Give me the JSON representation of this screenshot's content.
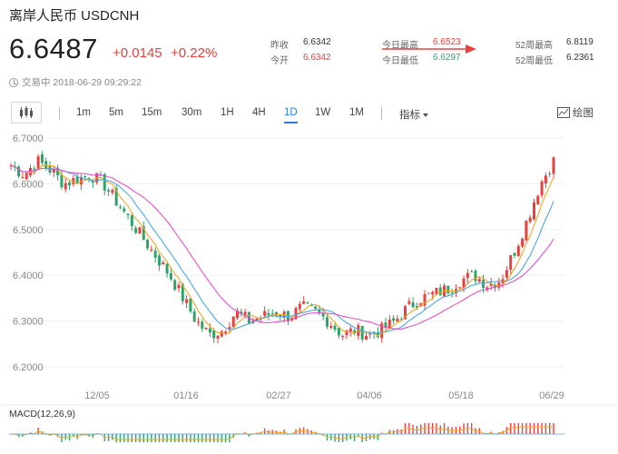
{
  "header": {
    "title": "离岸人民币  USDCNH",
    "price": "6.6487",
    "change_abs": "+0.0145",
    "change_pct": "+0.22%",
    "status": "交易中 2018-06-29 09:29:22"
  },
  "stats": {
    "prev_close_label": "昨收",
    "prev_close": "6.6342",
    "open_label": "今开",
    "open": "6.6342",
    "day_high_label": "今日最高",
    "day_high": "6.6523",
    "day_low_label": "今日最低",
    "day_low": "6.6297",
    "wk52_high_label": "52周最高",
    "wk52_high": "6.8119",
    "wk52_low_label": "52周最低",
    "wk52_low": "6.2361"
  },
  "toolbar": {
    "periods": [
      "1m",
      "5m",
      "15m",
      "30m",
      "1H",
      "4H",
      "1D",
      "1W",
      "1M"
    ],
    "active_period": "1D",
    "indicator_label": "指标",
    "draw_label": "绘图"
  },
  "colors": {
    "up": "#e8403f",
    "down": "#2ea46a",
    "ma_short": "#f5a623",
    "ma_mid": "#4aa8e8",
    "ma_long": "#e84fc8",
    "arrow": "#e8403f",
    "active": "#2c7be5"
  },
  "icons": [
    "candlestick-icon",
    "clock-icon",
    "draw-icon",
    "chevron-down-icon",
    "red-arrow-annotation"
  ],
  "chart_data": {
    "type": "candlestick",
    "yticks": [
      "6.7000",
      "6.6000",
      "6.5000",
      "6.4000",
      "6.3000",
      "6.2000"
    ],
    "ylim": [
      6.2,
      6.7
    ],
    "xticks": [
      "12/05",
      "01/16",
      "02/27",
      "04/06",
      "05/18",
      "06/29"
    ],
    "macd_label": "MACD(12,26,9)",
    "close_path": [
      6.64,
      6.62,
      6.65,
      6.63,
      6.6,
      6.61,
      6.62,
      6.6,
      6.56,
      6.52,
      6.48,
      6.44,
      6.4,
      6.35,
      6.3,
      6.27,
      6.28,
      6.32,
      6.3,
      6.31,
      6.32,
      6.31,
      6.33,
      6.32,
      6.3,
      6.27,
      6.28,
      6.27,
      6.28,
      6.3,
      6.33,
      6.35,
      6.36,
      6.37,
      6.39,
      6.4,
      6.38,
      6.39,
      6.45,
      6.52,
      6.6,
      6.65
    ]
  }
}
